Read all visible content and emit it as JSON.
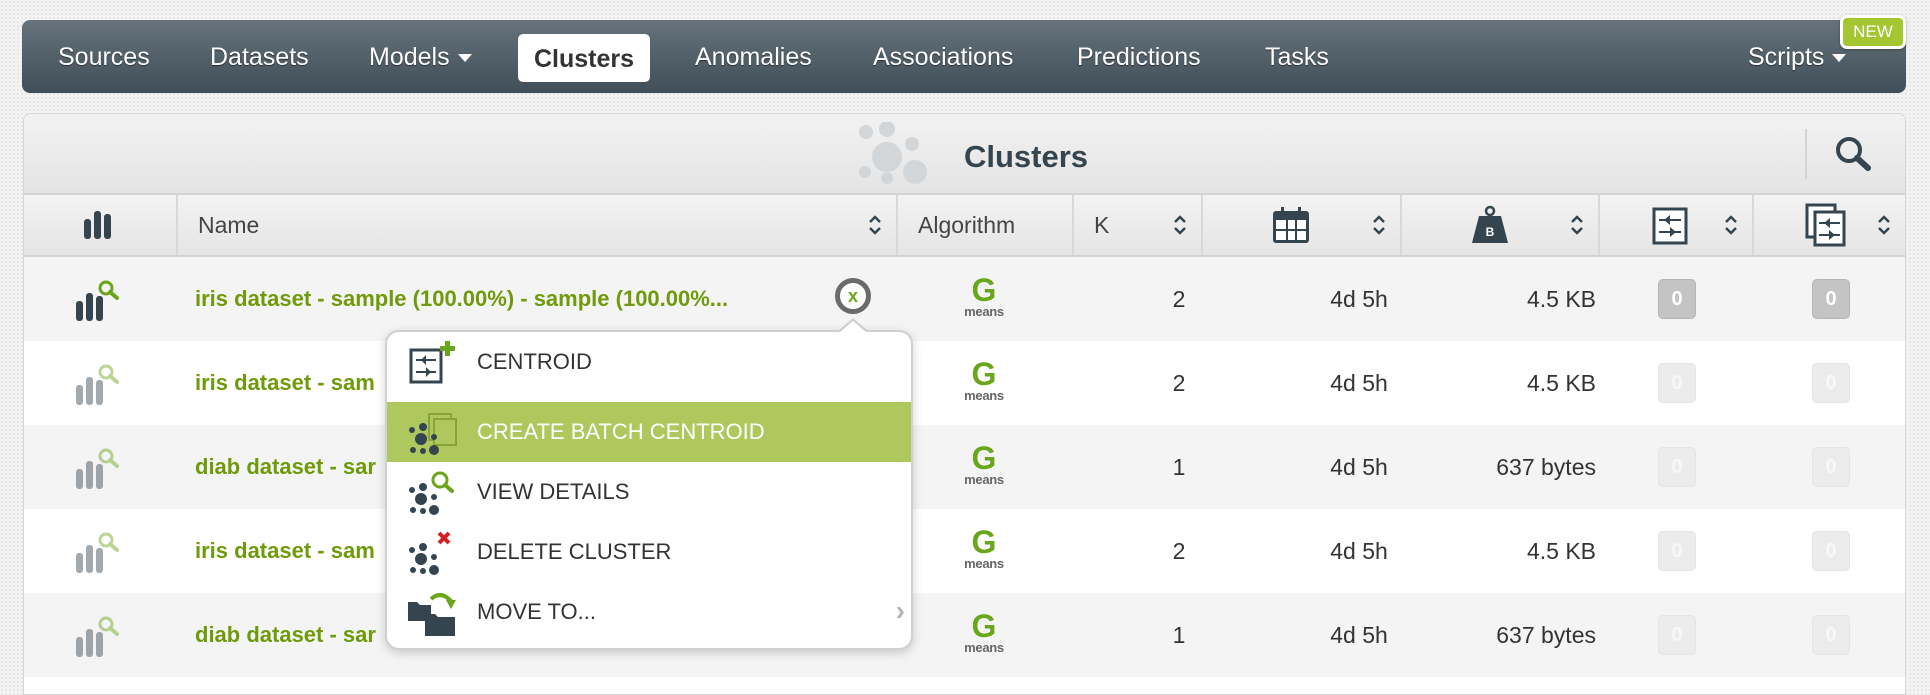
{
  "navbar": {
    "items": [
      {
        "label": "Sources"
      },
      {
        "label": "Datasets"
      },
      {
        "label": "Models",
        "dropdown": true
      },
      {
        "label": "Clusters",
        "active": true
      },
      {
        "label": "Anomalies"
      },
      {
        "label": "Associations"
      },
      {
        "label": "Predictions"
      },
      {
        "label": "Tasks"
      },
      {
        "label": "Scripts",
        "dropdown": true
      }
    ],
    "new_badge": "NEW"
  },
  "panel": {
    "title": "Clusters",
    "title_icon": "clusters-icon",
    "search_icon": "search-icon"
  },
  "table": {
    "columns": [
      {
        "key": "type",
        "icon": "bar-chart-icon"
      },
      {
        "key": "name",
        "label": "Name",
        "sortable": true
      },
      {
        "key": "algorithm",
        "label": "Algorithm"
      },
      {
        "key": "k",
        "label": "K",
        "sortable": true
      },
      {
        "key": "age",
        "icon": "calendar-icon",
        "sortable": true
      },
      {
        "key": "size",
        "icon": "weight-bytes-icon",
        "sortable": true
      },
      {
        "key": "centroids",
        "icon": "centroid-icon",
        "sortable": true
      },
      {
        "key": "batch_centroids",
        "icon": "batch-centroid-icon",
        "sortable": true
      }
    ],
    "rows": [
      {
        "name": "iris dataset - sample (100.00%) - sample (100.00%...",
        "algorithm_top": "G",
        "algorithm_bottom": "means",
        "k": "2",
        "age": "4d 5h",
        "size": "4.5 KB",
        "centroids": "0",
        "batch_centroids": "0",
        "selected": true
      },
      {
        "name": "iris dataset - sam",
        "algorithm_top": "G",
        "algorithm_bottom": "means",
        "k": "2",
        "age": "4d 5h",
        "size": "4.5 KB",
        "centroids": "0",
        "batch_centroids": "0"
      },
      {
        "name": "diab dataset - sar",
        "algorithm_top": "G",
        "algorithm_bottom": "means",
        "k": "1",
        "age": "4d 5h",
        "size": "637 bytes",
        "centroids": "0",
        "batch_centroids": "0"
      },
      {
        "name": "iris dataset - sam",
        "algorithm_top": "G",
        "algorithm_bottom": "means",
        "k": "2",
        "age": "4d 5h",
        "size": "4.5 KB",
        "centroids": "0",
        "batch_centroids": "0"
      },
      {
        "name": "diab dataset - sar",
        "algorithm_top": "G",
        "algorithm_bottom": "means",
        "k": "1",
        "age": "4d 5h",
        "size": "637 bytes",
        "centroids": "0",
        "batch_centroids": "0"
      }
    ]
  },
  "close_button": {
    "glyph": "x"
  },
  "context_menu": {
    "items": [
      {
        "label": "CENTROID",
        "icon": "centroid-add-icon"
      },
      {
        "label": "CREATE BATCH CENTROID",
        "icon": "batch-centroid-icon",
        "highlighted": true
      },
      {
        "label": "VIEW DETAILS",
        "icon": "cluster-view-icon"
      },
      {
        "label": "DELETE CLUSTER",
        "icon": "cluster-delete-icon"
      },
      {
        "label": "MOVE TO...",
        "icon": "move-folder-icon",
        "submenu": true
      }
    ],
    "chevron": "›"
  },
  "colors": {
    "accent_green": "#afc85d",
    "link_green": "#6f9a0a",
    "navbar_dark": "#3f4e58",
    "icon_dark": "#34454f",
    "delete_red": "#d42020"
  }
}
